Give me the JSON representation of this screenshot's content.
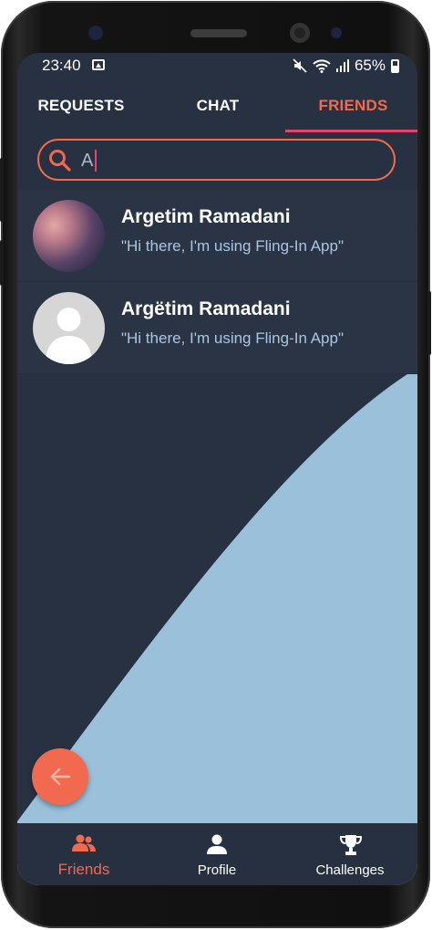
{
  "status_bar": {
    "time": "23:40",
    "battery_text": "65%"
  },
  "tabs": [
    {
      "label": "REQUESTS",
      "active": false
    },
    {
      "label": "CHAT",
      "active": false
    },
    {
      "label": "FRIENDS",
      "active": true
    }
  ],
  "search": {
    "value": "A",
    "placeholder": ""
  },
  "results": [
    {
      "name": "Argetim Ramadani",
      "status": "\"Hi there, I'm using Fling-In App\"",
      "avatar": "blurred-photo"
    },
    {
      "name": "Argëtim Ramadani",
      "status": "\"Hi there, I'm using Fling-In App\"",
      "avatar": "default-person"
    }
  ],
  "fab": {
    "icon": "arrow-left-icon"
  },
  "bottom_nav": [
    {
      "label": "Friends",
      "icon": "friends-icon",
      "active": true
    },
    {
      "label": "Profile",
      "icon": "person-icon",
      "active": false
    },
    {
      "label": "Challenges",
      "icon": "trophy-icon",
      "active": false
    }
  ],
  "colors": {
    "background": "#283141",
    "accent": "#f16a4f",
    "tab_indicator": "#e8426b",
    "wave": "#9ac0da",
    "status_text": "#a9c6e3"
  }
}
